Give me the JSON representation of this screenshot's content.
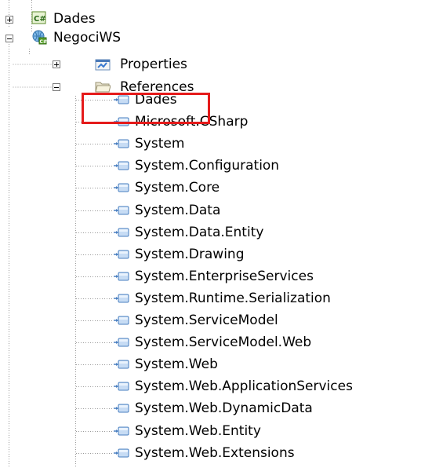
{
  "tree": {
    "nodes": [
      {
        "label": "Dades",
        "icon": "csharp-project-icon",
        "state": "collapsed"
      },
      {
        "label": "NegociWS",
        "icon": "web-project-icon",
        "state": "expanded"
      },
      {
        "label": "Properties",
        "icon": "properties-icon",
        "state": "collapsed"
      },
      {
        "label": "References",
        "icon": "folder-open-icon",
        "state": "expanded"
      }
    ],
    "references": [
      "Dades",
      "Microsoft.CSharp",
      "System",
      "System.Configuration",
      "System.Core",
      "System.Data",
      "System.Data.Entity",
      "System.Drawing",
      "System.EnterpriseServices",
      "System.Runtime.Serialization",
      "System.ServiceModel",
      "System.ServiceModel.Web",
      "System.Web",
      "System.Web.ApplicationServices",
      "System.Web.DynamicData",
      "System.Web.Entity",
      "System.Web.Extensions"
    ],
    "highlighted_reference": "Dades",
    "highlight_color": "#e51b1b"
  }
}
